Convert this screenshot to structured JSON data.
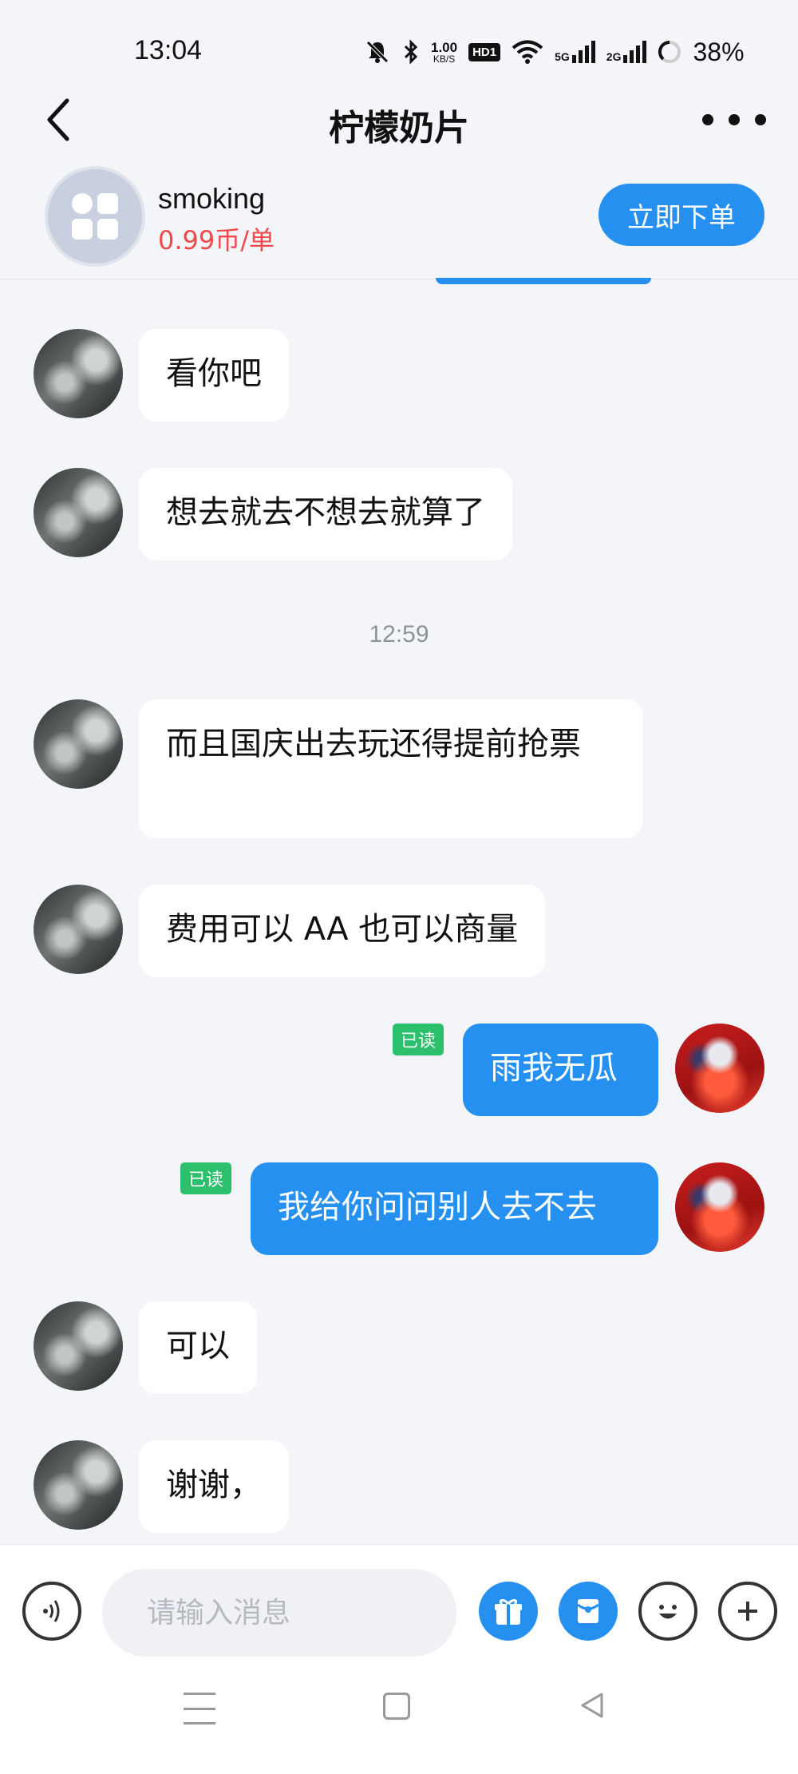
{
  "status_bar": {
    "time": "13:04",
    "net_speed": "1.00",
    "net_unit": "KB/S",
    "hd_label": "HD1",
    "signal1": "5G",
    "signal2": "2G",
    "battery": "38%"
  },
  "header": {
    "title": "柠檬奶片"
  },
  "product": {
    "name": "smoking",
    "price": "0.99币/单",
    "order_button": "立即下单"
  },
  "messages": [
    {
      "side": "in",
      "text": "看你吧"
    },
    {
      "side": "in",
      "text": "想去就去不想去就算了"
    },
    {
      "side": "in",
      "text": "而且国庆出去玩还得提前抢票"
    },
    {
      "side": "in",
      "text": "费用可以 AA 也可以商量"
    },
    {
      "side": "out",
      "text": "雨我无瓜",
      "status": "已读"
    },
    {
      "side": "out",
      "text": "我给你问问别人去不去",
      "status": "已读"
    },
    {
      "side": "in",
      "text": "可以"
    },
    {
      "side": "in",
      "text": "谢谢，"
    }
  ],
  "time_separator": "12:59",
  "input": {
    "placeholder": "请输入消息"
  },
  "colors": {
    "accent": "#2590f0",
    "price": "#f04a4a",
    "read_badge": "#2cbf6c",
    "background": "#f3f5f9"
  },
  "icons": {
    "back": "chevron-left-icon",
    "more": "more-dots-icon",
    "voice": "voice-icon",
    "gift": "gift-icon",
    "red_packet": "red-packet-icon",
    "emoji": "emoji-icon",
    "plus": "plus-icon"
  }
}
